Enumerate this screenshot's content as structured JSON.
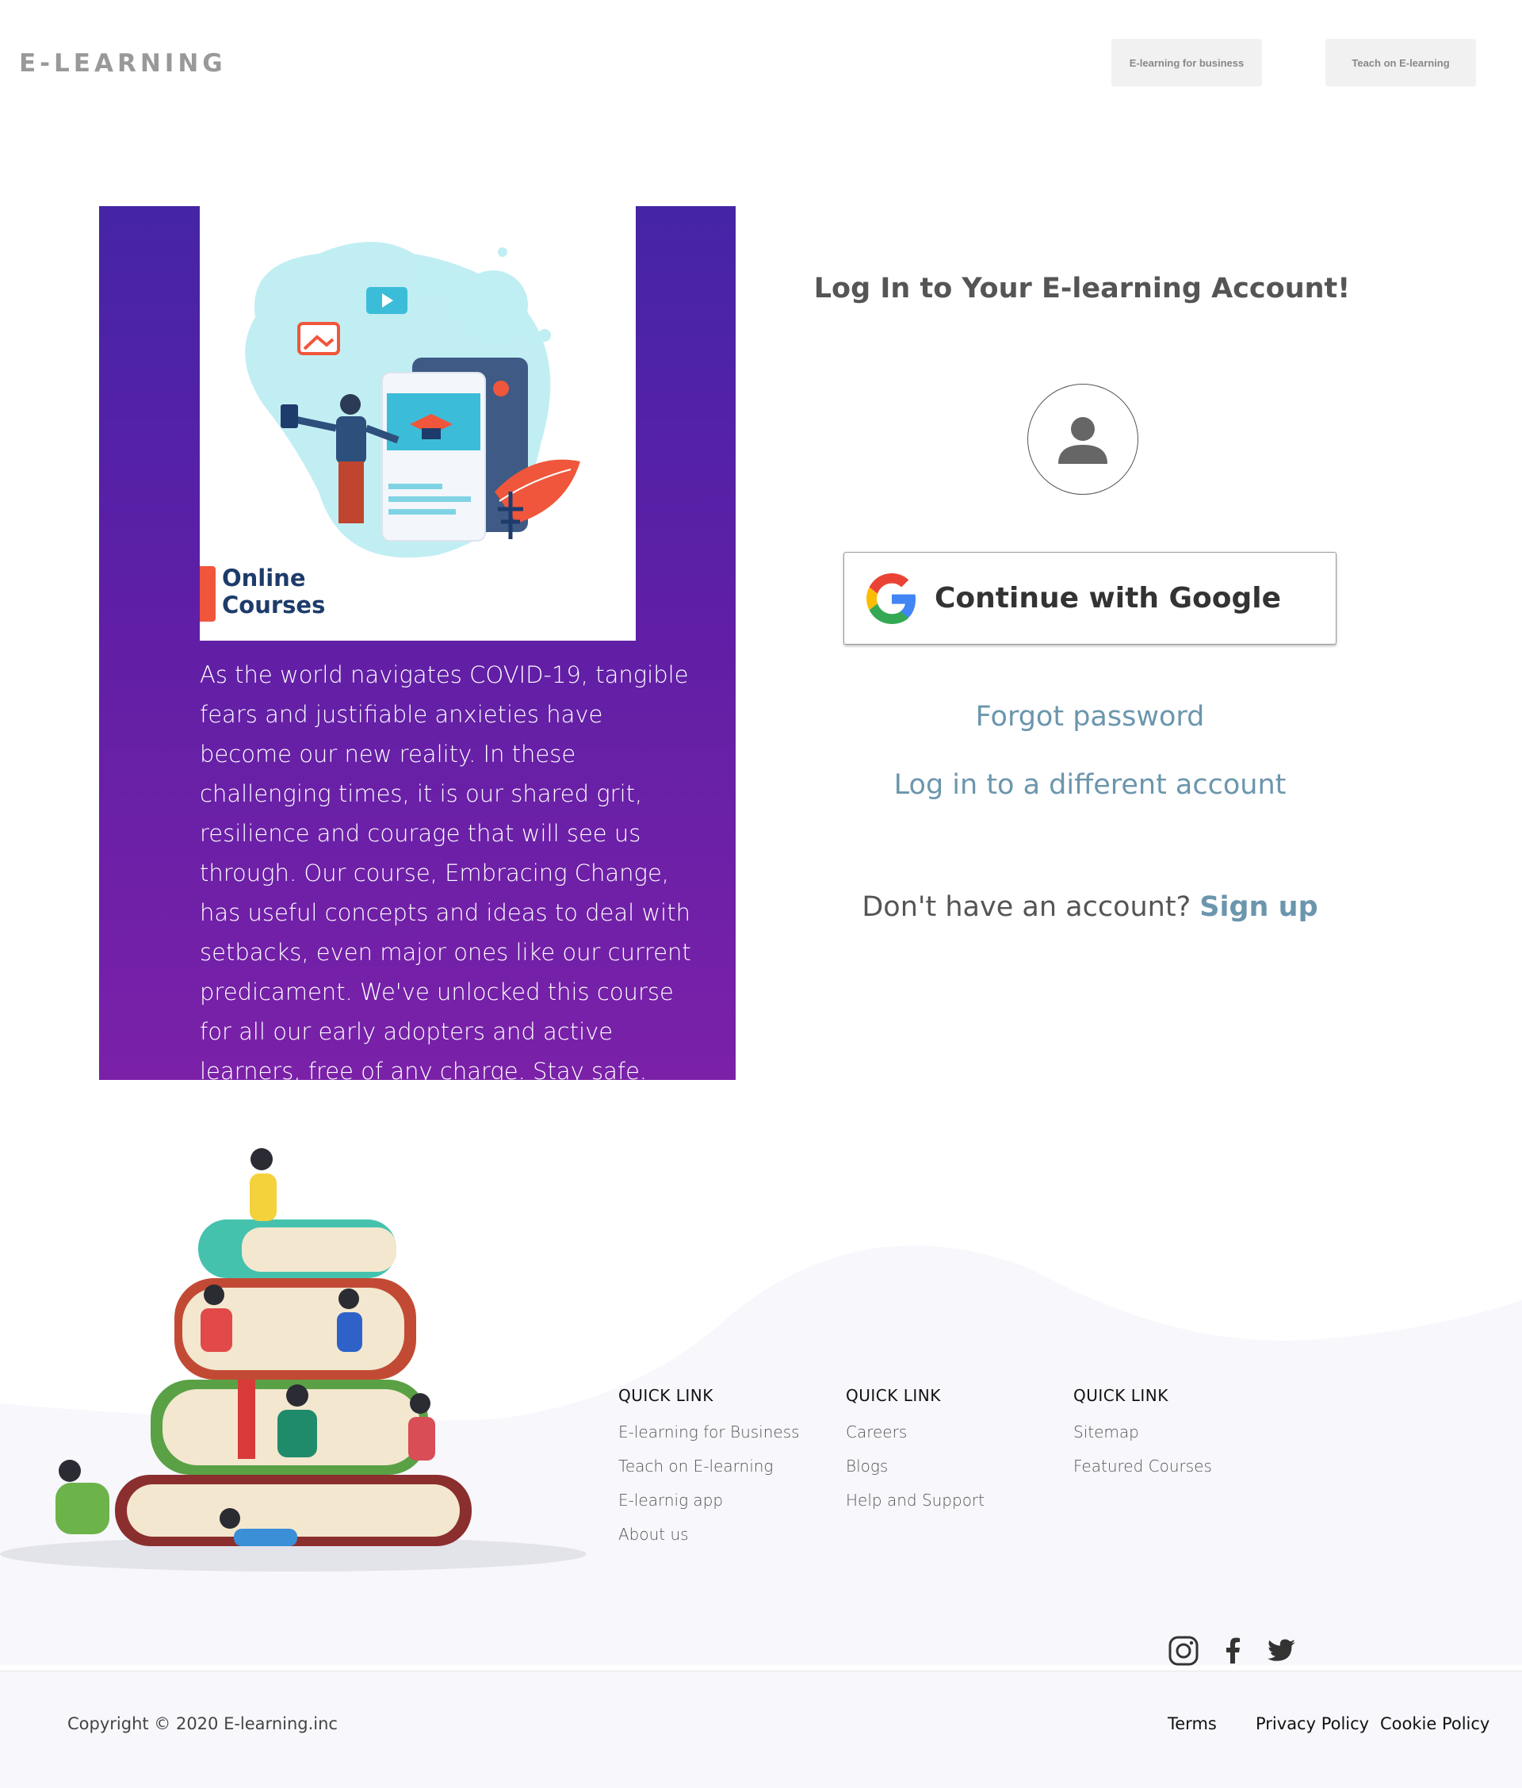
{
  "header": {
    "logo": "E-LEARNING",
    "business_button": "E-learning for business",
    "teach_button": "Teach on E-learning"
  },
  "promo": {
    "image_caption": "Online\nCourses",
    "text": "As the world navigates COVID-19, tangible fears and justifiable anxieties have become our new reality. In these challenging times, it is our shared grit, resilience and courage that will see us through. Our course, Embracing Change, has useful concepts and ideas to deal with setbacks, even major ones like our current predicament. We've unlocked this course for all our early adopters and active learners, free of any charge. Stay safe."
  },
  "login": {
    "title": "Log In to Your E-learning Account!",
    "google_button": "Continue with Google",
    "forgot_password": "Forgot password",
    "different_account": "Log in to a different account",
    "no_account": "Don't have an account?",
    "sign_up": "Sign up"
  },
  "footer": {
    "columns": [
      {
        "heading": "QUICK LINK",
        "links": [
          "E-learning for Business",
          "Teach on E-learning",
          "E-learnig app",
          "About us"
        ]
      },
      {
        "heading": "QUICK LINK",
        "links": [
          "Careers",
          "Blogs",
          "Help and Support"
        ]
      },
      {
        "heading": "QUICK LINK",
        "links": [
          "Sitemap",
          "Featured Courses"
        ]
      }
    ],
    "social": [
      "instagram-icon",
      "facebook-icon",
      "twitter-icon"
    ],
    "copyright": "Copyright © 2020 E-learning.inc",
    "legal": [
      "Terms",
      "Privacy Policy",
      "Cookie Policy"
    ]
  },
  "colors": {
    "promo_top": "#4525a5",
    "promo_bottom": "#7a21a8",
    "link": "#6b96ad",
    "logo": "#999999"
  }
}
